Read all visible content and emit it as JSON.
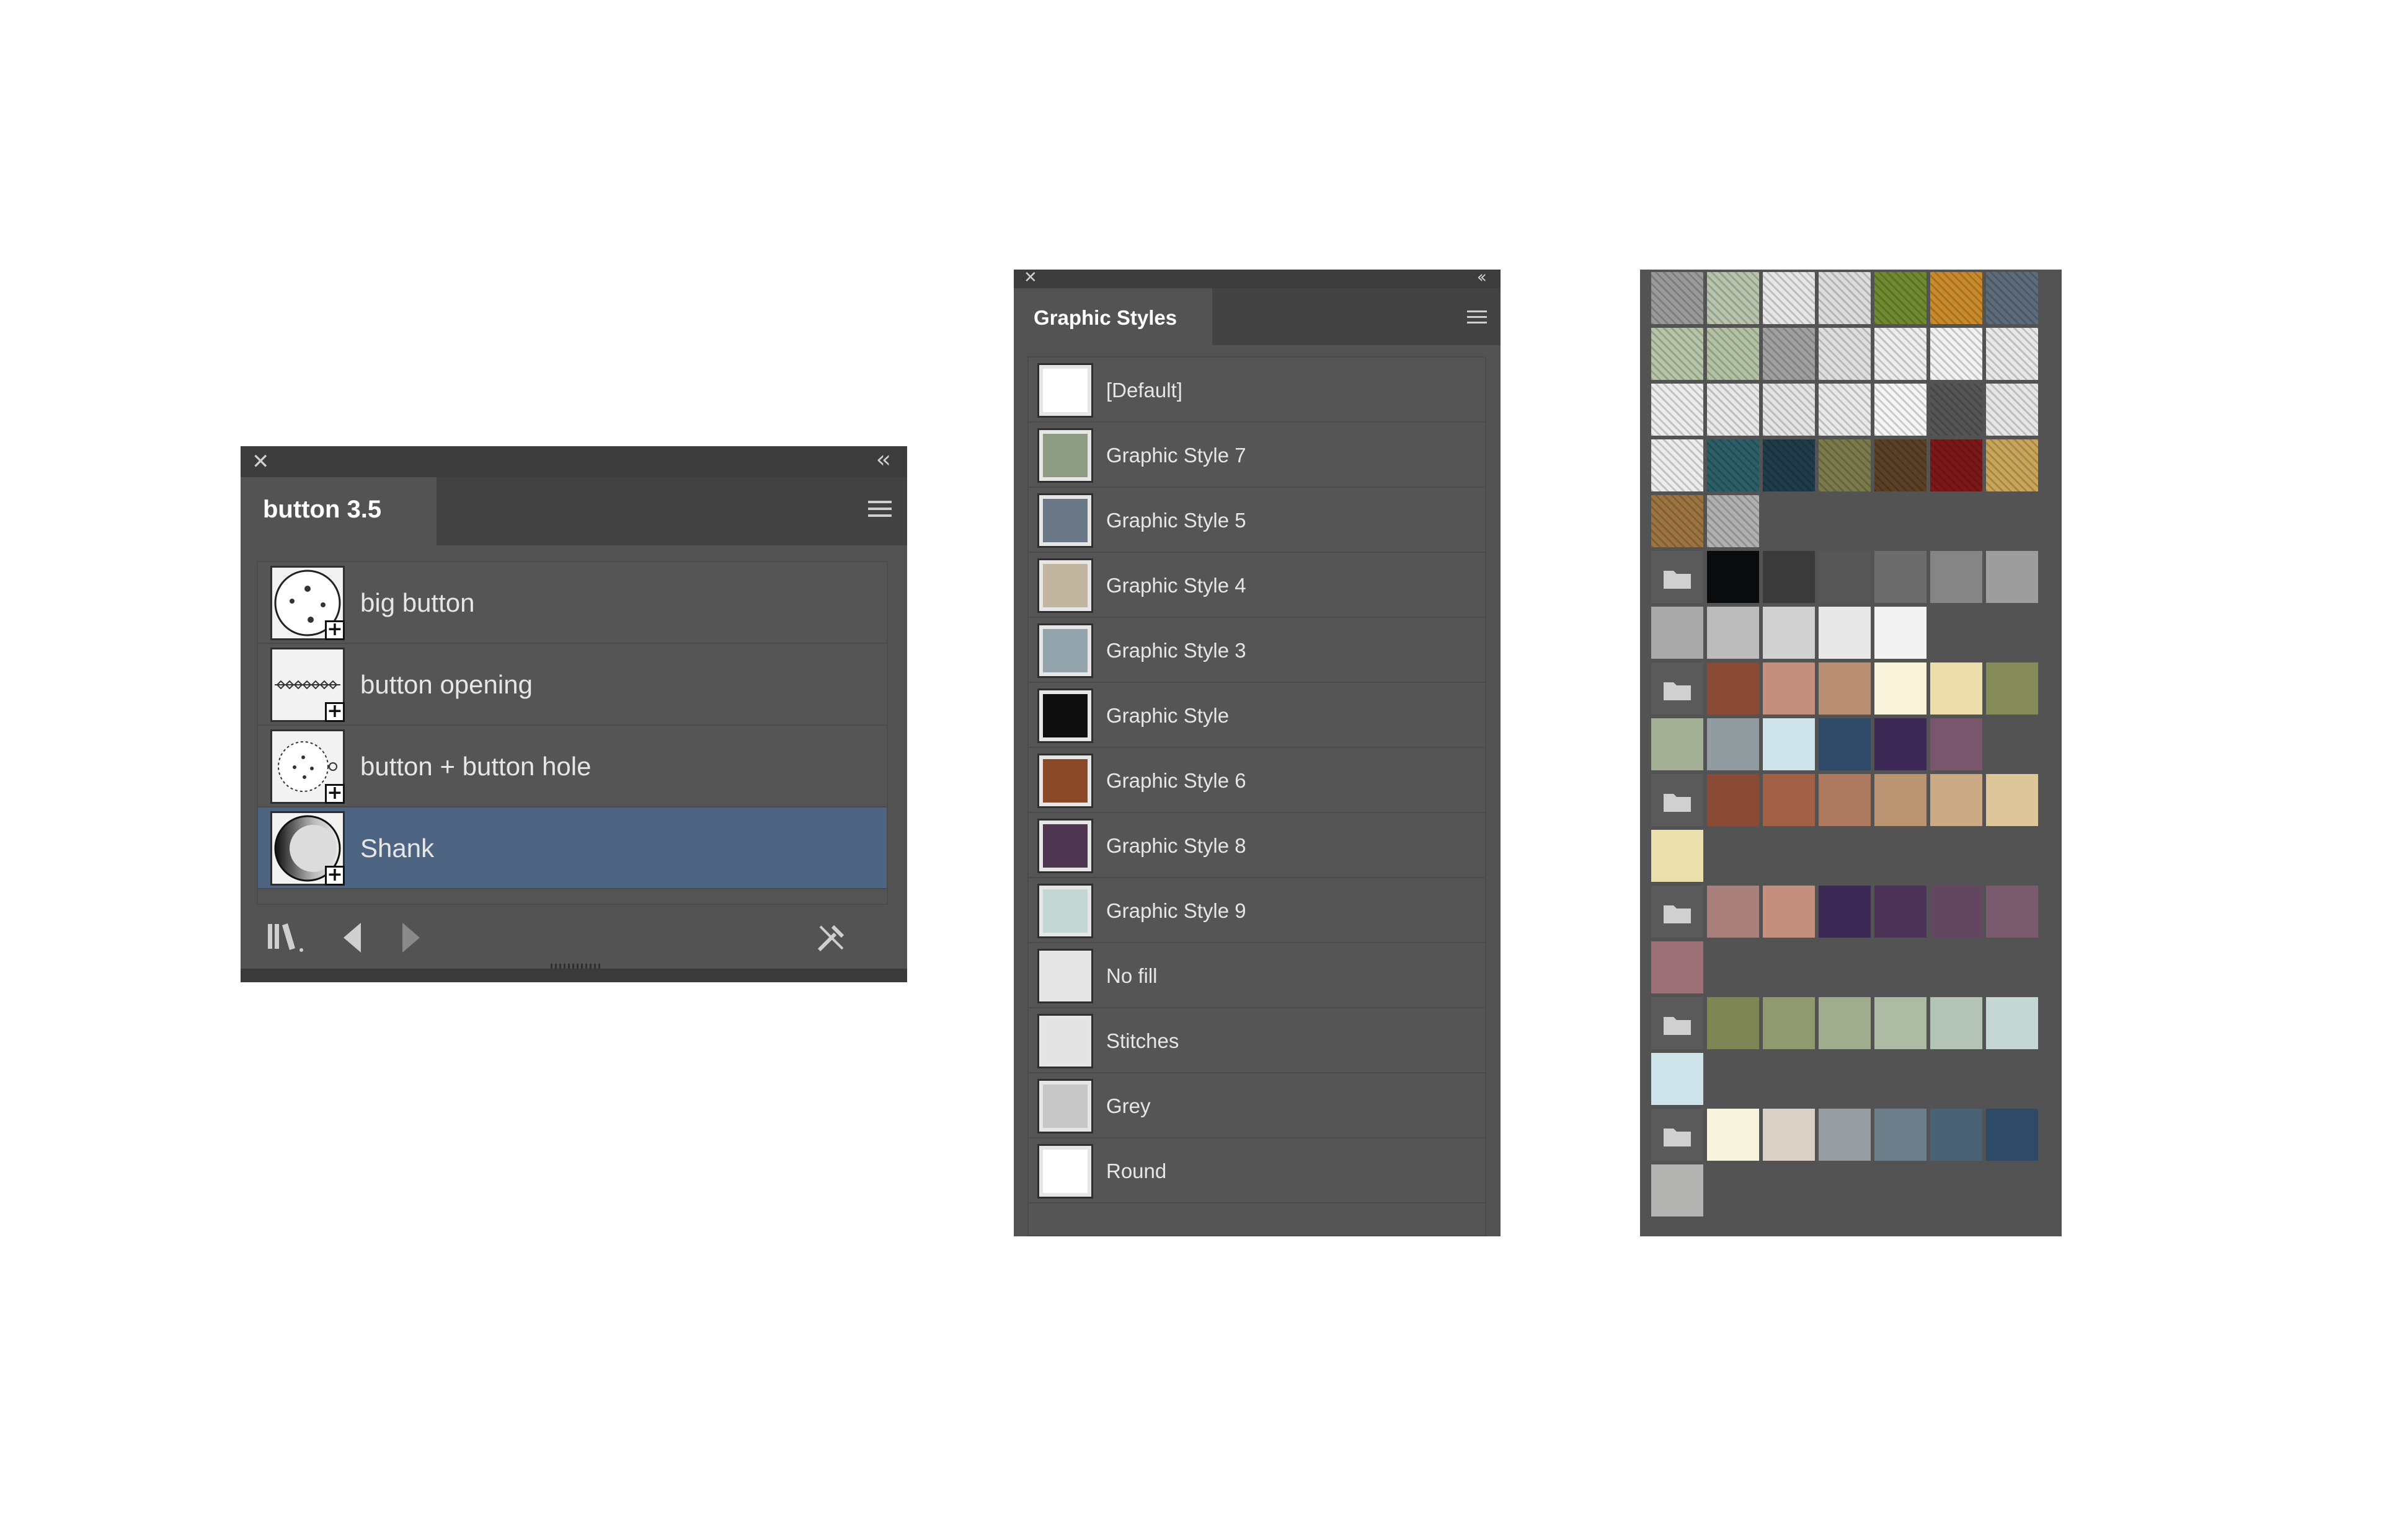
{
  "symbols_panel": {
    "tab_title": "button 3.5",
    "close_label": "✕",
    "collapse_label": "‹‹",
    "items": [
      {
        "label": "big button",
        "icon": "button-four-holes-icon",
        "selected": false
      },
      {
        "label": "button opening",
        "icon": "stitch-line-icon",
        "selected": false
      },
      {
        "label": "button + button hole",
        "icon": "button-with-hole-icon",
        "selected": false
      },
      {
        "label": "Shank",
        "icon": "shank-gradient-icon",
        "selected": true
      }
    ],
    "footer_icons": [
      "symbol-libraries-icon",
      "previous-library-icon",
      "next-library-icon",
      "break-link-icon"
    ]
  },
  "graphic_styles_panel": {
    "tab_title": "Graphic Styles",
    "close_label": "✕",
    "collapse_label": "‹‹",
    "items": [
      {
        "label": "[Default]",
        "thumb": "#ffffff"
      },
      {
        "label": "Graphic Style 7",
        "thumb": "#8d9a84"
      },
      {
        "label": "Graphic Style 5",
        "thumb": "#6a7787"
      },
      {
        "label": "Graphic Style 4",
        "thumb": "#c2b6a0"
      },
      {
        "label": "Graphic Style 3",
        "thumb": "#93a4ad"
      },
      {
        "label": "Graphic Style",
        "thumb": "#0d0d0d"
      },
      {
        "label": "Graphic Style 6",
        "thumb": "#8a4a2a"
      },
      {
        "label": "Graphic Style 8",
        "thumb": "#4e3550"
      },
      {
        "label": "Graphic Style 9",
        "thumb": "#c3d6d4"
      },
      {
        "label": "No fill",
        "thumb": "#e6e6e6"
      },
      {
        "label": "Stitches",
        "thumb": "#e4e4e4"
      },
      {
        "label": "Grey",
        "thumb": "#c8c8c8"
      },
      {
        "label": "Round",
        "thumb": "#ffffff"
      }
    ]
  },
  "swatches_panel": {
    "pattern_rows": [
      [
        "#9a9a9a",
        "#b8c4ad",
        "#e6e6e6",
        "#dcdcdc",
        "#6f8a2f",
        "#c98a2a",
        "#5d6b7a"
      ],
      [
        "#b7c4a8",
        "#b3c2a3",
        "#a0a0a0",
        "#dedede",
        "#ededed",
        "#f2f2f2",
        "#e8e8e8"
      ],
      [
        "#ececec",
        "#e8e8e8",
        "#e4e4e4",
        "#e9e9e9",
        "#f5f5f5",
        "#555555",
        "#e6e6e6"
      ],
      [
        "#ececec",
        "#2b5e66",
        "#1f3c4a",
        "#7a7a4a",
        "#5a4025",
        "#7d1818",
        "#c9a55a"
      ],
      [
        "#9c7440",
        "#b0b0b0"
      ]
    ],
    "color_groups": [
      {
        "swatches": [
          "#090b0c",
          "#3a3a3a",
          "#575757",
          "#6c6c6c",
          "#858585",
          "#9d9d9d",
          "#a9a9a9",
          "#bcbcbc",
          "#d1d1d1",
          "#e8e8e8",
          "#f3f3f3"
        ]
      },
      {
        "swatches": [
          "#8b4a36",
          "#c58f7e",
          "#b99073",
          "#faf3dc",
          "#ebddac",
          "#858c5a",
          "#a4b095",
          "#929ca0",
          "#cfe3ea",
          "#2f4a68",
          "#3c2855",
          "#7a566c"
        ]
      },
      {
        "swatches": [
          "#8b4a36",
          "#a26049",
          "#ae7a5f",
          "#bb9474",
          "#cca985",
          "#dcc69a",
          "#ebe0ad"
        ]
      },
      {
        "swatches": [
          "#a97f7b",
          "#c58f7e",
          "#3c2855",
          "#4d3358",
          "#634760",
          "#795b6d",
          "#9d7078"
        ]
      },
      {
        "swatches": [
          "#7e8655",
          "#8f9a6e",
          "#9fac8e",
          "#adbba5",
          "#b3c3b6",
          "#c4d7d4",
          "#cfe3ea"
        ]
      },
      {
        "swatches": [
          "#f8f3dc",
          "#d9d1c5",
          "#979ea3",
          "#6d7e8b",
          "#4b6275",
          "#2f4a68",
          "#b3b3b1"
        ]
      }
    ]
  }
}
